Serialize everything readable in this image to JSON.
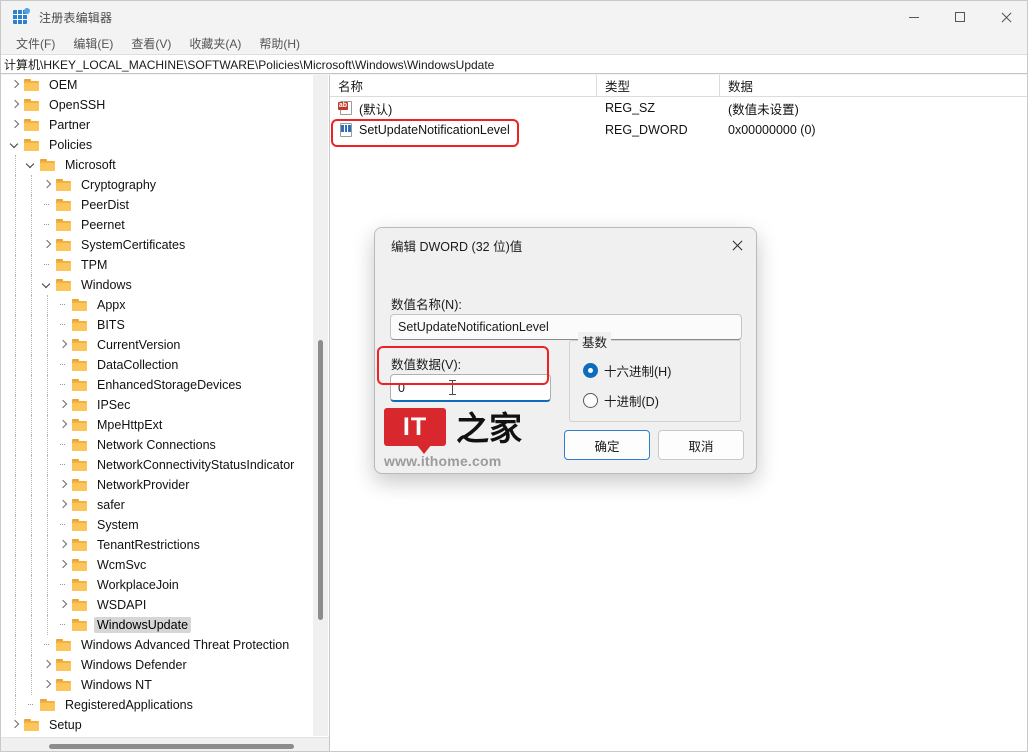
{
  "window": {
    "title": "注册表编辑器",
    "icon": "registry-editor-icon",
    "minimize_label": "最小化",
    "maximize_label": "最大化",
    "close_label": "关闭"
  },
  "menubar": {
    "items": [
      {
        "label": "文件(F)"
      },
      {
        "label": "编辑(E)"
      },
      {
        "label": "查看(V)"
      },
      {
        "label": "收藏夹(A)"
      },
      {
        "label": "帮助(H)"
      }
    ]
  },
  "address": {
    "path": "计算机\\HKEY_LOCAL_MACHINE\\SOFTWARE\\Policies\\Microsoft\\Windows\\WindowsUpdate"
  },
  "tree": {
    "items": [
      {
        "label": "OEM",
        "depth": 1,
        "state": "collapsed",
        "selected": false
      },
      {
        "label": "OpenSSH",
        "depth": 1,
        "state": "collapsed",
        "selected": false
      },
      {
        "label": "Partner",
        "depth": 1,
        "state": "collapsed",
        "selected": false
      },
      {
        "label": "Policies",
        "depth": 1,
        "state": "expanded",
        "selected": false
      },
      {
        "label": "Microsoft",
        "depth": 2,
        "state": "expanded",
        "selected": false
      },
      {
        "label": "Cryptography",
        "depth": 3,
        "state": "collapsed",
        "selected": false
      },
      {
        "label": "PeerDist",
        "depth": 3,
        "state": "leaf",
        "selected": false
      },
      {
        "label": "Peernet",
        "depth": 3,
        "state": "leaf",
        "selected": false
      },
      {
        "label": "SystemCertificates",
        "depth": 3,
        "state": "collapsed",
        "selected": false
      },
      {
        "label": "TPM",
        "depth": 3,
        "state": "leaf",
        "selected": false
      },
      {
        "label": "Windows",
        "depth": 3,
        "state": "expanded",
        "selected": false
      },
      {
        "label": "Appx",
        "depth": 4,
        "state": "leaf",
        "selected": false
      },
      {
        "label": "BITS",
        "depth": 4,
        "state": "leaf",
        "selected": false
      },
      {
        "label": "CurrentVersion",
        "depth": 4,
        "state": "collapsed",
        "selected": false
      },
      {
        "label": "DataCollection",
        "depth": 4,
        "state": "leaf",
        "selected": false
      },
      {
        "label": "EnhancedStorageDevices",
        "depth": 4,
        "state": "leaf",
        "selected": false
      },
      {
        "label": "IPSec",
        "depth": 4,
        "state": "collapsed",
        "selected": false
      },
      {
        "label": "MpeHttpExt",
        "depth": 4,
        "state": "collapsed",
        "selected": false
      },
      {
        "label": "Network Connections",
        "depth": 4,
        "state": "leaf",
        "selected": false
      },
      {
        "label": "NetworkConnectivityStatusIndicator",
        "depth": 4,
        "state": "leaf",
        "selected": false
      },
      {
        "label": "NetworkProvider",
        "depth": 4,
        "state": "collapsed",
        "selected": false
      },
      {
        "label": "safer",
        "depth": 4,
        "state": "collapsed",
        "selected": false
      },
      {
        "label": "System",
        "depth": 4,
        "state": "leaf",
        "selected": false
      },
      {
        "label": "TenantRestrictions",
        "depth": 4,
        "state": "collapsed",
        "selected": false
      },
      {
        "label": "WcmSvc",
        "depth": 4,
        "state": "collapsed",
        "selected": false
      },
      {
        "label": "WorkplaceJoin",
        "depth": 4,
        "state": "leaf",
        "selected": false
      },
      {
        "label": "WSDAPI",
        "depth": 4,
        "state": "collapsed",
        "selected": false
      },
      {
        "label": "WindowsUpdate",
        "depth": 4,
        "state": "leaf",
        "selected": true
      },
      {
        "label": "Windows Advanced Threat Protection",
        "depth": 3,
        "state": "leaf",
        "selected": false
      },
      {
        "label": "Windows Defender",
        "depth": 3,
        "state": "collapsed",
        "selected": false
      },
      {
        "label": "Windows NT",
        "depth": 3,
        "state": "collapsed",
        "selected": false
      },
      {
        "label": "RegisteredApplications",
        "depth": 2,
        "state": "leaf",
        "selected": false
      },
      {
        "label": "Setup",
        "depth": 1,
        "state": "collapsed",
        "selected": false
      }
    ]
  },
  "values": {
    "columns": [
      {
        "label": "名称"
      },
      {
        "label": "类型"
      },
      {
        "label": "数据"
      }
    ],
    "rows": [
      {
        "icon": "string-value-icon",
        "name": "(默认)",
        "type": "REG_SZ",
        "data": "(数值未设置)"
      },
      {
        "icon": "dword-value-icon",
        "name": "SetUpdateNotificationLevel",
        "type": "REG_DWORD",
        "data": "0x00000000 (0)"
      }
    ]
  },
  "dialog": {
    "title": "编辑 DWORD (32 位)值",
    "close_label": "关闭",
    "name_label": "数值名称(N):",
    "name_value": "SetUpdateNotificationLevel",
    "data_label": "数值数据(V):",
    "data_value": "0",
    "radix_legend": "基数",
    "radix_options": [
      {
        "label": "十六进制(H)",
        "checked": true
      },
      {
        "label": "十进制(D)",
        "checked": false
      }
    ],
    "ok_label": "确定",
    "cancel_label": "取消"
  },
  "watermark": {
    "logo_text": "IT",
    "brand_text": "之家",
    "url": "www.ithome.com"
  },
  "colors": {
    "accent": "#0f6cbd",
    "annotation": "#ee2222",
    "folder": "#fcc55a",
    "selection": "#d6d6d6",
    "logo_red": "#d9272e"
  }
}
